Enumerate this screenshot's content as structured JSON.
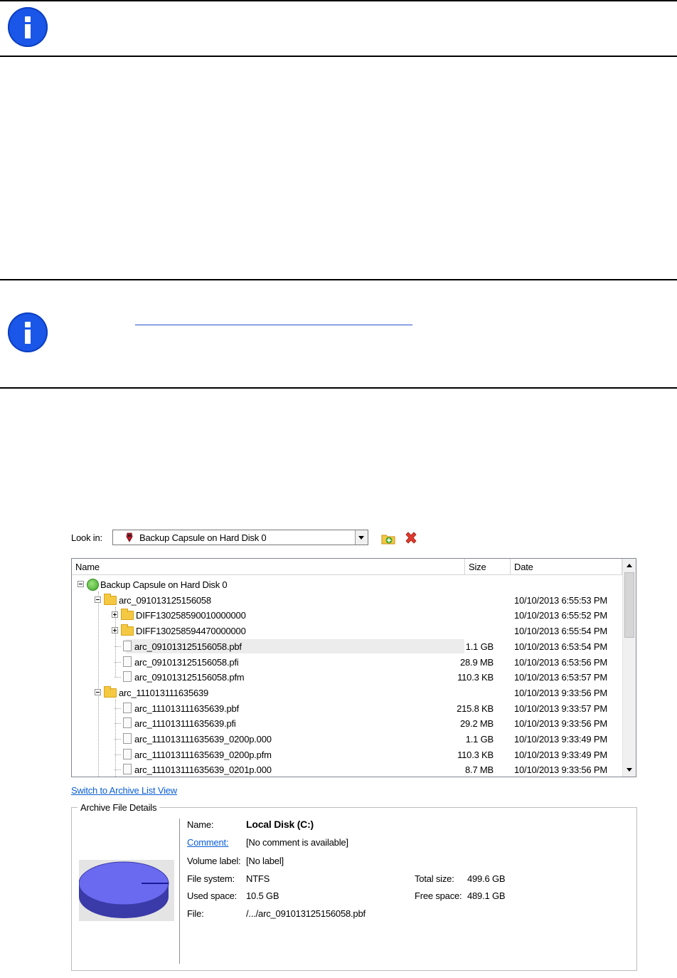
{
  "lookin": {
    "label": "Look in:",
    "selected": "Backup Capsule on Hard Disk 0"
  },
  "tree": {
    "columns": [
      "Name",
      "Size",
      "Date"
    ],
    "rows": [
      {
        "name": "Backup Capsule on Hard Disk 0",
        "size": "",
        "date": ""
      },
      {
        "name": "arc_091013125156058",
        "size": "",
        "date": "10/10/2013 6:55:53 PM"
      },
      {
        "name": "DIFF130258590010000000",
        "size": "",
        "date": "10/10/2013 6:55:52 PM"
      },
      {
        "name": "DIFF130258594470000000",
        "size": "",
        "date": "10/10/2013 6:55:54 PM"
      },
      {
        "name": "arc_091013125156058.pbf",
        "size": "1.1 GB",
        "date": "10/10/2013 6:53:54 PM"
      },
      {
        "name": "arc_091013125156058.pfi",
        "size": "28.9 MB",
        "date": "10/10/2013 6:53:56 PM"
      },
      {
        "name": "arc_091013125156058.pfm",
        "size": "110.3 KB",
        "date": "10/10/2013 6:53:57 PM"
      },
      {
        "name": "arc_111013111635639",
        "size": "",
        "date": "10/10/2013 9:33:56 PM"
      },
      {
        "name": "arc_111013111635639.pbf",
        "size": "215.8 KB",
        "date": "10/10/2013 9:33:57 PM"
      },
      {
        "name": "arc_111013111635639.pfi",
        "size": "29.2 MB",
        "date": "10/10/2013 9:33:56 PM"
      },
      {
        "name": "arc_111013111635639_0200p.000",
        "size": "1.1 GB",
        "date": "10/10/2013 9:33:49 PM"
      },
      {
        "name": "arc_111013111635639_0200p.pfm",
        "size": "110.3 KB",
        "date": "10/10/2013 9:33:49 PM"
      },
      {
        "name": "arc_111013111635639_0201p.000",
        "size": "8.7 MB",
        "date": "10/10/2013 9:33:56 PM"
      }
    ]
  },
  "switch_link": "Switch to Archive List View",
  "details": {
    "title": "Archive File Details",
    "name_label": "Name:",
    "name_value": "Local Disk (C:)",
    "comment_label": "Comment:",
    "comment_value": "[No comment is available]",
    "volume_label": "Volume label:",
    "volume_value": "[No label]",
    "fs_label": "File system:",
    "fs_value": "NTFS",
    "used_label": "Used space:",
    "used_value": "10.5 GB",
    "file_label": "File:",
    "file_value": "/.../arc_091013125156058.pbf",
    "total_label": "Total size:",
    "total_value": "499.6 GB",
    "free_label": "Free space:",
    "free_value": "489.1 GB"
  }
}
